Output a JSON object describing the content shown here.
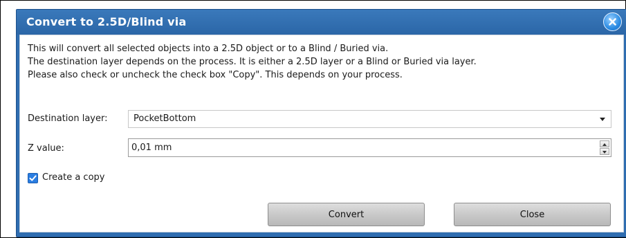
{
  "dialog": {
    "title": "Convert to 2.5D/Blind via",
    "close_icon": "close-x-icon",
    "description_lines": [
      "This will convert all selected objects into a 2.5D object or to a Blind / Buried via.",
      "The destination layer depends on the process. It is either a 2.5D layer or a Blind or Buried via layer.",
      "Please also check or uncheck the check box \"Copy\". This depends on your process."
    ],
    "destination_layer": {
      "label": "Destination layer:",
      "value": "PocketBottom"
    },
    "z_value": {
      "label": "Z value:",
      "value": "0,01 mm"
    },
    "copy_checkbox": {
      "label": "Create a copy",
      "checked": true
    },
    "buttons": {
      "convert": "Convert",
      "close": "Close"
    },
    "colors": {
      "titlebar": "#2f6db0",
      "checkbox": "#2a7de1",
      "close_button": "#2a8be3"
    }
  }
}
